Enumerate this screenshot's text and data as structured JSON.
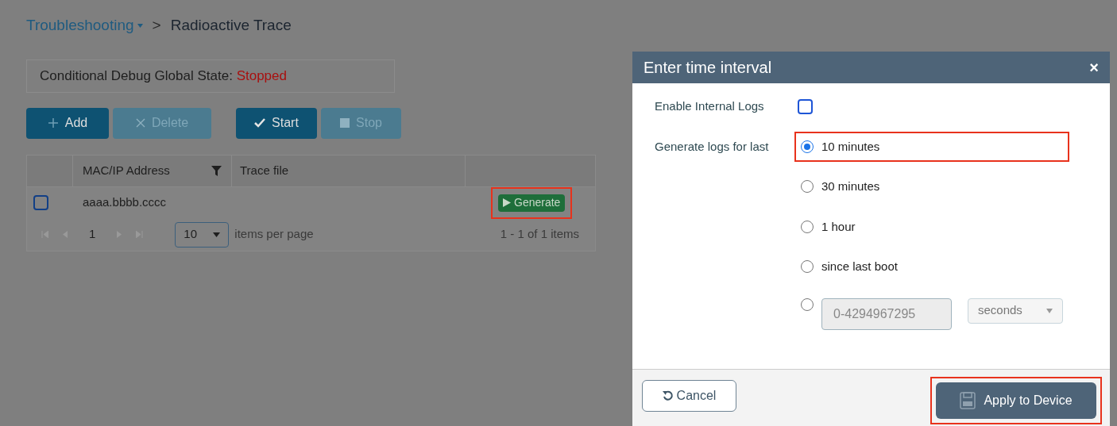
{
  "breadcrumb": {
    "parent": "Troubleshooting",
    "separator": ">",
    "current": "Radioactive Trace"
  },
  "status": {
    "label": "Conditional Debug Global State:",
    "value": "Stopped"
  },
  "toolbar": [
    {
      "kind": "add",
      "label": "Add",
      "disabled": false
    },
    {
      "kind": "delete",
      "label": "Delete",
      "disabled": true
    },
    {
      "kind": "start",
      "label": "Start",
      "disabled": false
    },
    {
      "kind": "stop",
      "label": "Stop",
      "disabled": true
    }
  ],
  "table": {
    "columns": [
      "MAC/IP Address",
      "Trace file"
    ],
    "rows": [
      {
        "checked": false,
        "address": "aaaa.bbbb.cccc",
        "action": "Generate",
        "highlighted": true
      }
    ],
    "pager": {
      "page": "1",
      "page_size": "10",
      "page_size_label": "items per page",
      "summary": "1 - 1 of 1 items"
    }
  },
  "dialog": {
    "title": "Enter time interval",
    "close": "×",
    "internal_logs": {
      "label": "Enable Internal Logs",
      "checked": false
    },
    "period_label": "Generate logs for last",
    "options": [
      {
        "kind": "radio",
        "label": "10 minutes",
        "selected": true,
        "highlighted": true
      },
      {
        "kind": "radio",
        "label": "30 minutes",
        "selected": false,
        "highlighted": false
      },
      {
        "kind": "radio",
        "label": "1 hour",
        "selected": false,
        "highlighted": false
      },
      {
        "kind": "radio",
        "label": "since last boot",
        "selected": false,
        "highlighted": false
      },
      {
        "kind": "custom",
        "placeholder": "0-4294967295",
        "unit": "seconds",
        "selected": false,
        "highlighted": false
      }
    ],
    "cancel": "Cancel",
    "apply": {
      "label": "Apply to Device",
      "highlighted": true
    }
  }
}
